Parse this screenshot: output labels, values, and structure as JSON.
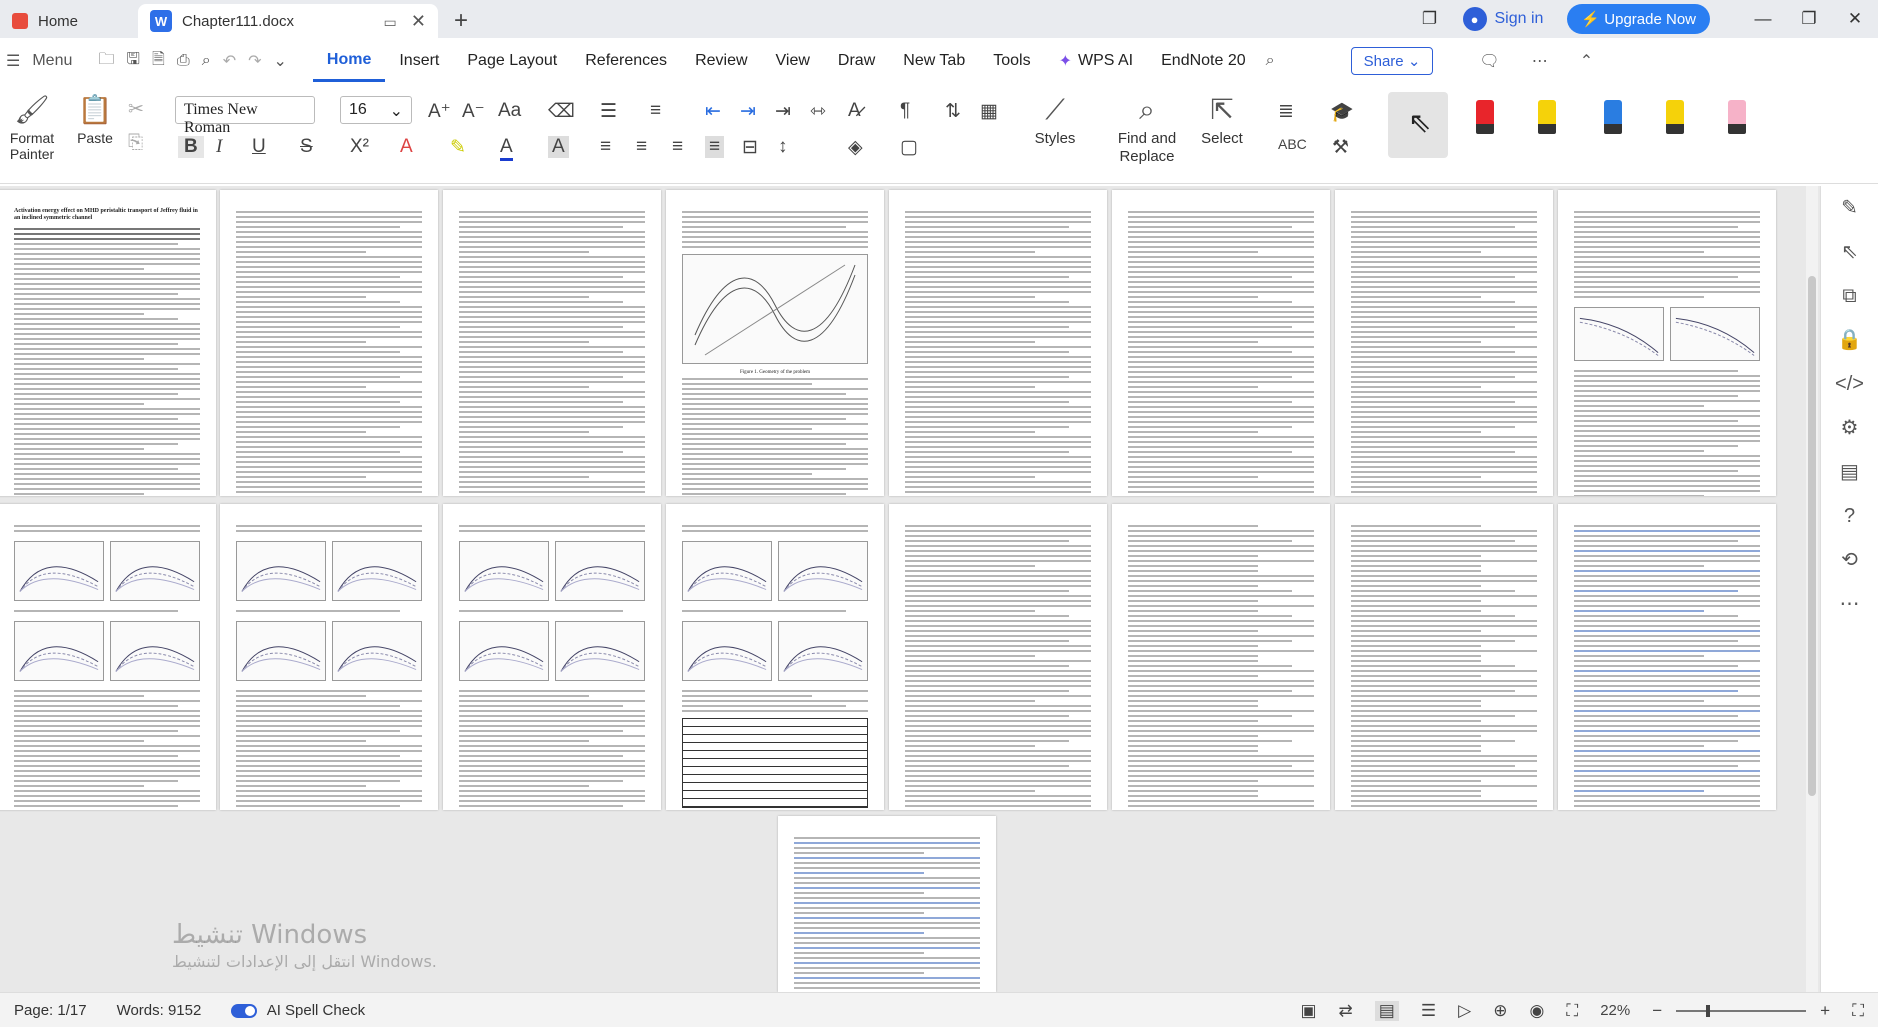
{
  "titlebar": {
    "home_tab": "Home",
    "doc_tab": "Chapter111.docx",
    "doc_icon_letter": "W",
    "sign_in": "Sign in",
    "upgrade": "Upgrade Now"
  },
  "menu": {
    "menu_label": "Menu",
    "tabs": [
      "Home",
      "Insert",
      "Page Layout",
      "References",
      "Review",
      "View",
      "Draw",
      "New Tab",
      "Tools",
      "WPS AI",
      "EndNote 20"
    ],
    "active_tab": "Home",
    "share": "Share"
  },
  "ribbon": {
    "format_painter": "Format Painter",
    "paste": "Paste",
    "font_name": "Times New Roman",
    "font_size": "16",
    "styles": "Styles",
    "find_replace": "Find and Replace",
    "select": "Select",
    "bold": "B",
    "italic": "I",
    "underline": "U",
    "pen_colors": [
      "#e8252b",
      "#f5d20a",
      "#2a7de1",
      "#f5d20a",
      "#f6b2c8"
    ]
  },
  "document": {
    "page1_title": "Activation energy effect on MHD peristaltic transport of Jeffrey fluid in an inclined symmetric channel",
    "fig_caption": "Figure 1. Geometry of the problem"
  },
  "watermark": {
    "line1": "تنشيط Windows",
    "line2": "انتقل إلى الإعدادات لتنشيط Windows."
  },
  "status": {
    "page": "Page: 1/17",
    "words": "Words: 9152",
    "spell": "AI Spell Check",
    "zoom": "22%"
  }
}
